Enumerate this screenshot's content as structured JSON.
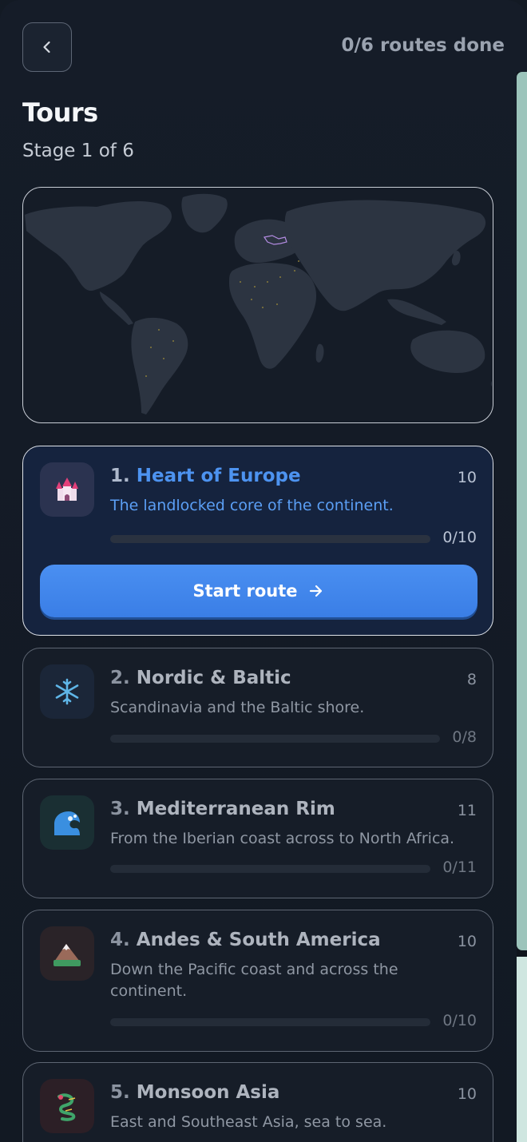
{
  "header": {
    "back_icon": "chevron-left-icon",
    "progress_text": "0/6 routes done",
    "title": "Tours",
    "subtitle": "Stage 1 of 6"
  },
  "colors": {
    "accent": "#4d93f0",
    "active_card_bg": "#15233e",
    "scrollbar_thumb": "#9cc4bb"
  },
  "routes": [
    {
      "num": "1.",
      "name": "Heart of Europe",
      "count": "10",
      "desc": "The landlocked core of the continent.",
      "progress": "0/10",
      "progress_value": 0,
      "icon": "castle-icon",
      "active": true
    },
    {
      "num": "2.",
      "name": "Nordic & Baltic",
      "count": "8",
      "desc": "Scandinavia and the Baltic shore.",
      "progress": "0/8",
      "progress_value": 0,
      "icon": "snowflake-icon",
      "active": false
    },
    {
      "num": "3.",
      "name": "Mediterranean Rim",
      "count": "11",
      "desc": "From the Iberian coast across to North Africa.",
      "progress": "0/11",
      "progress_value": 0,
      "icon": "wave-icon",
      "active": false
    },
    {
      "num": "4.",
      "name": "Andes & South America",
      "count": "10",
      "desc": "Down the Pacific coast and across the continent.",
      "progress": "0/10",
      "progress_value": 0,
      "icon": "mountain-icon",
      "active": false
    },
    {
      "num": "5.",
      "name": "Monsoon Asia",
      "count": "10",
      "desc": "East and Southeast Asia, sea to sea.",
      "progress": "",
      "progress_value": 0,
      "icon": "dragon-icon",
      "active": false
    }
  ],
  "start_button": {
    "label": "Start route",
    "icon": "arrow-right-icon"
  }
}
